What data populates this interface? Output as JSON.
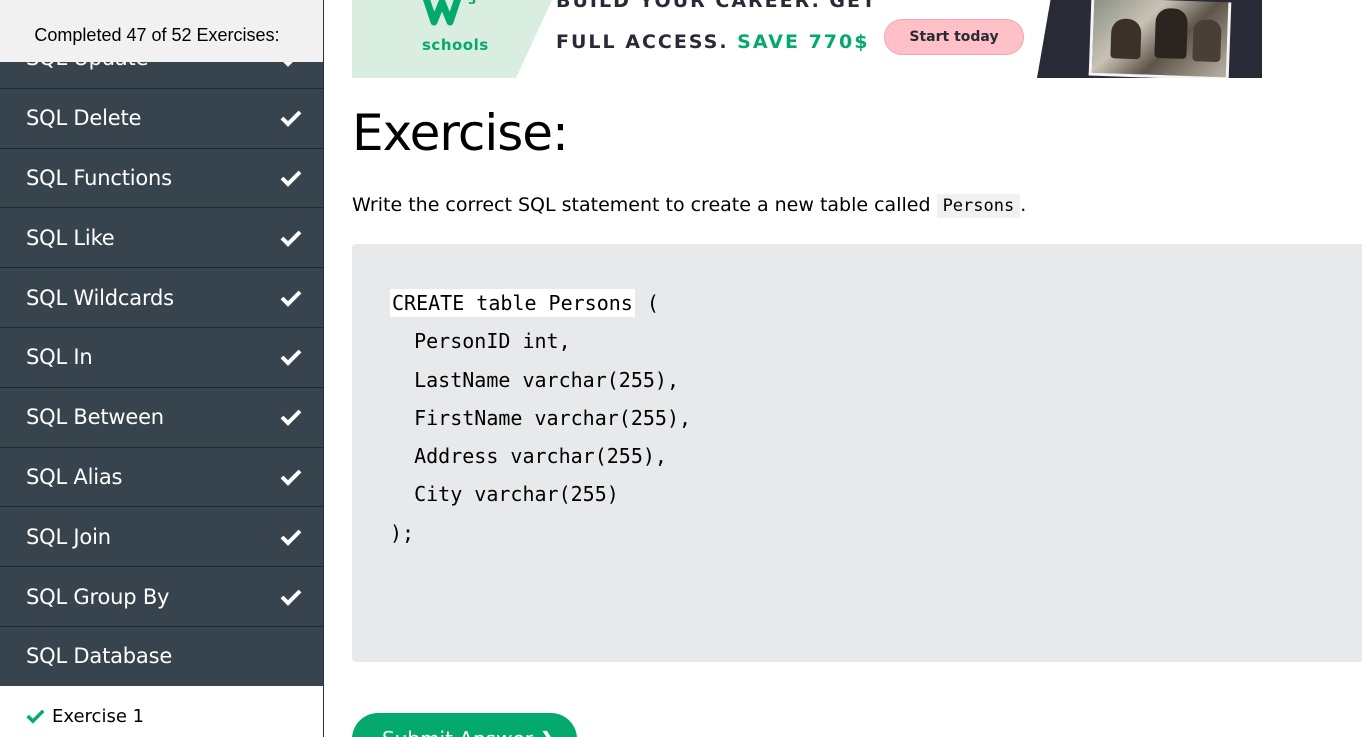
{
  "sidebar": {
    "progress_text": "Completed 47 of 52 Exercises:",
    "items": [
      {
        "label": "SQL Update",
        "completed": true
      },
      {
        "label": "SQL Delete",
        "completed": true
      },
      {
        "label": "SQL Functions",
        "completed": true
      },
      {
        "label": "SQL Like",
        "completed": true
      },
      {
        "label": "SQL Wildcards",
        "completed": true
      },
      {
        "label": "SQL In",
        "completed": true
      },
      {
        "label": "SQL Between",
        "completed": true
      },
      {
        "label": "SQL Alias",
        "completed": true
      },
      {
        "label": "SQL Join",
        "completed": true
      },
      {
        "label": "SQL Group By",
        "completed": true
      },
      {
        "label": "SQL Database",
        "completed": false
      }
    ],
    "sub_item": {
      "label": "Exercise 1",
      "completed": true
    }
  },
  "banner": {
    "logo_text": "schools",
    "line1": "BUILD YOUR CAREER. GET",
    "line2_prefix": "FULL ACCESS.",
    "line2_highlight": "SAVE 770$",
    "cta_label": "Start today"
  },
  "main": {
    "title": "Exercise:",
    "instruction_prefix": "Write the correct SQL statement to create a new table called",
    "instruction_code": "Persons",
    "instruction_suffix": ".",
    "code": {
      "input_value": "CREATE table Persons",
      "first_line_rest": " (",
      "lines": [
        "  PersonID int,",
        "  LastName varchar(255),",
        "  FirstName varchar(255),",
        "  Address varchar(255),",
        "  City varchar(255)",
        ");"
      ]
    },
    "submit_label": "Submit Answer ❯"
  },
  "colors": {
    "sidebar_bg": "#38444d",
    "accent_green": "#04aa6d",
    "code_bg": "#e7e9eb"
  }
}
